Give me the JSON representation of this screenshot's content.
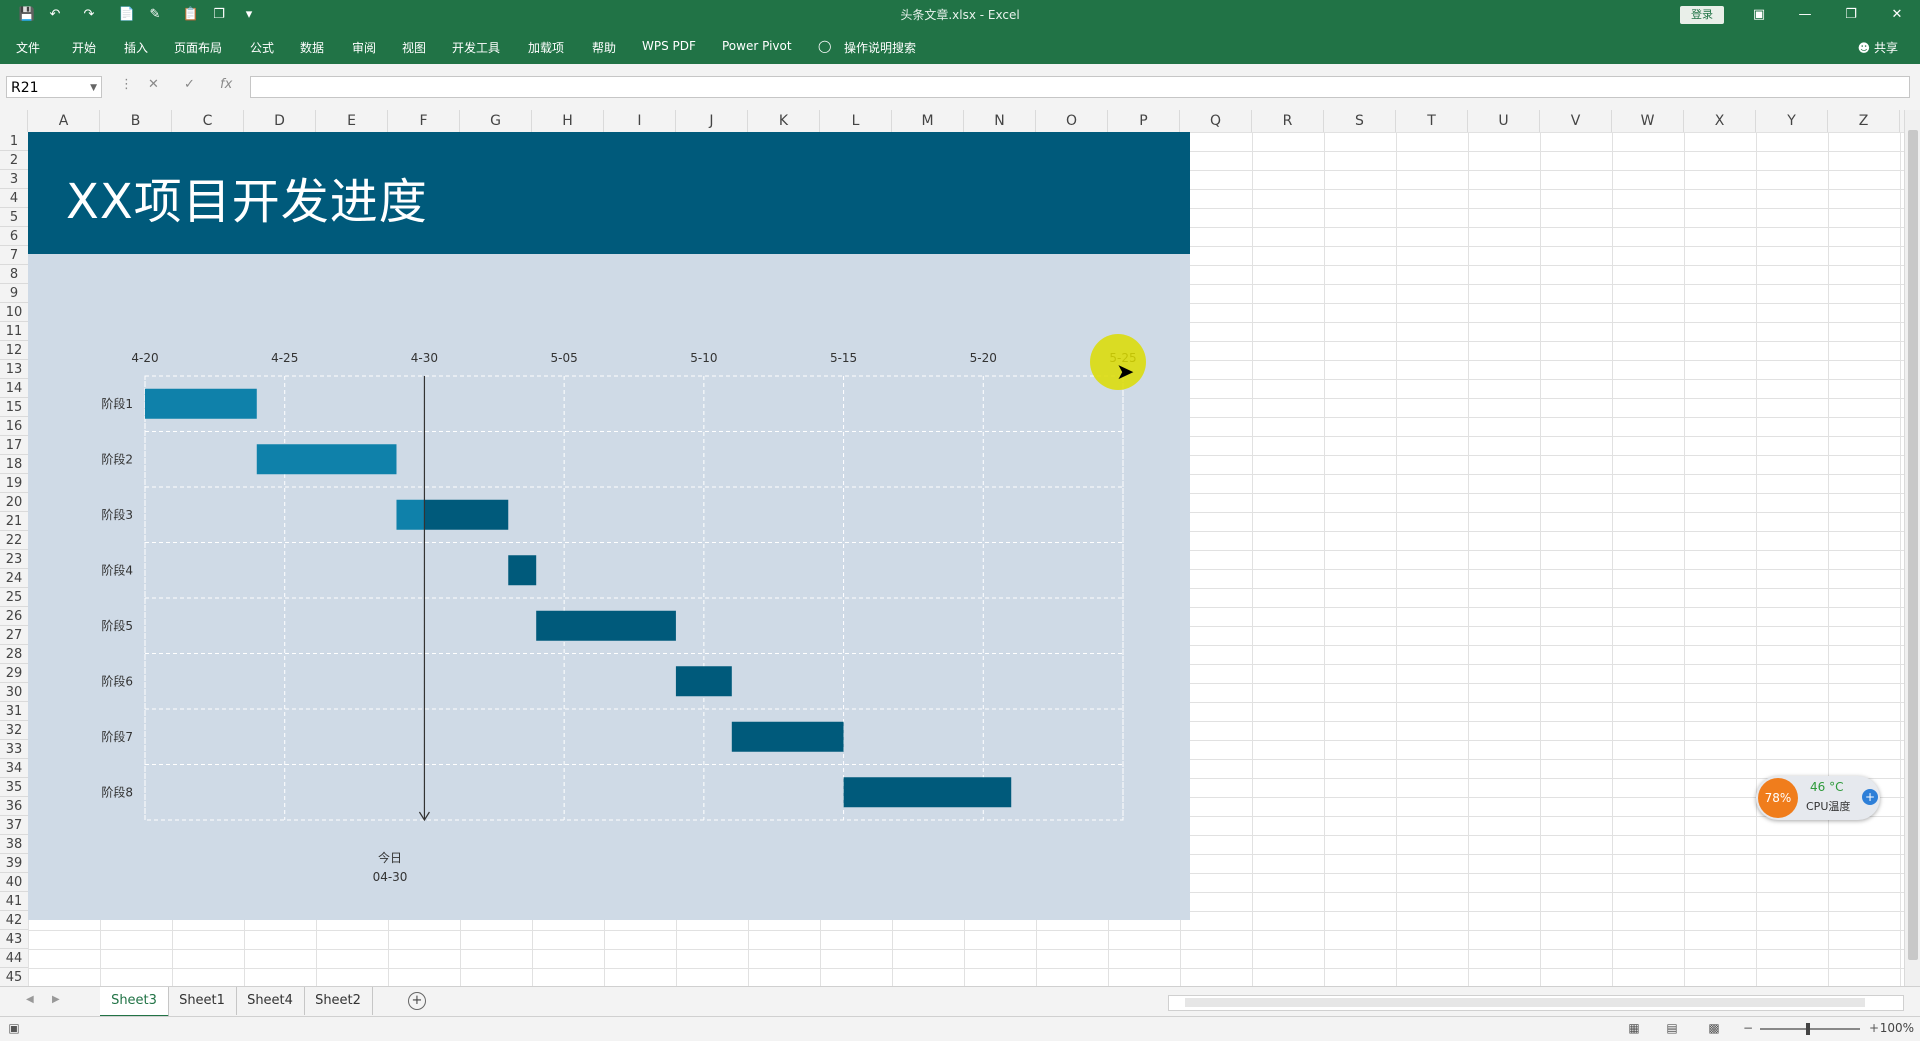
{
  "titlebar": {
    "window_title": "头条文章.xlsx  -  Excel",
    "login_label": "登录"
  },
  "ribbon": {
    "tabs": [
      "文件",
      "开始",
      "插入",
      "页面布局",
      "公式",
      "数据",
      "审阅",
      "视图",
      "开发工具",
      "加载项",
      "帮助",
      "WPS PDF",
      "Power Pivot",
      "操作说明搜索"
    ],
    "share_label": "共享"
  },
  "formula_bar": {
    "name_box": "R21",
    "formula": ""
  },
  "columns": [
    "A",
    "B",
    "C",
    "D",
    "E",
    "F",
    "G",
    "H",
    "I",
    "J",
    "K",
    "L",
    "M",
    "N",
    "O",
    "P",
    "Q",
    "R",
    "S",
    "T",
    "U",
    "V",
    "W",
    "X",
    "Y",
    "Z"
  ],
  "rows": [
    "1",
    "2",
    "3",
    "4",
    "5",
    "6",
    "7",
    "8",
    "9",
    "10",
    "11",
    "12",
    "13",
    "14",
    "15",
    "16",
    "17",
    "18",
    "19",
    "20",
    "21",
    "22",
    "23",
    "24",
    "25",
    "26",
    "27",
    "28",
    "29",
    "30",
    "31",
    "32",
    "33",
    "34",
    "35",
    "36",
    "37",
    "38",
    "39",
    "40",
    "41",
    "42",
    "43",
    "44",
    "45"
  ],
  "sheet": {
    "title": "XX项目开发进度",
    "today_label": "今日",
    "today_date": "04-30"
  },
  "chart_data": {
    "type": "bar",
    "orientation": "horizontal-gantt",
    "x_tick_labels": [
      "4-20",
      "4-25",
      "4-30",
      "5-05",
      "5-10",
      "5-15",
      "5-20",
      "5-25"
    ],
    "x_tick_day_values": [
      20,
      25,
      30,
      35,
      40,
      45,
      50,
      55
    ],
    "xlim_days_from_apr_1": [
      20,
      55
    ],
    "today_day": 30,
    "categories": [
      "阶段1",
      "阶段2",
      "阶段3",
      "阶段4",
      "阶段5",
      "阶段6",
      "阶段7",
      "阶段8"
    ],
    "tasks": [
      {
        "start": 20,
        "end": 24
      },
      {
        "start": 24,
        "end": 29
      },
      {
        "start": 29,
        "end": 33
      },
      {
        "start": 33,
        "end": 34
      },
      {
        "start": 34,
        "end": 39
      },
      {
        "start": 39,
        "end": 41
      },
      {
        "start": 41,
        "end": 45
      },
      {
        "start": 45,
        "end": 51
      }
    ],
    "colors": {
      "done": "#0f81aa",
      "pending": "#005a7b",
      "grid": "#ffffff",
      "today_line": "#333333"
    }
  },
  "sheet_tabs": [
    "Sheet3",
    "Sheet1",
    "Sheet4",
    "Sheet2"
  ],
  "active_sheet": "Sheet3",
  "status": {
    "zoom": "100%"
  },
  "cpu_widget": {
    "usage": "78%",
    "temp": "46 °C",
    "label": "CPU温度"
  }
}
